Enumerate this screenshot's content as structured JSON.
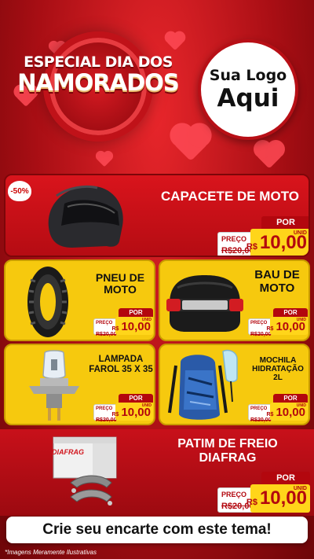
{
  "header": {
    "title_line_1": "ESPECIAL DIA DOS",
    "title_line_2": "NAMORADOS",
    "logo_line_1": "Sua Logo",
    "logo_line_2": "Aqui"
  },
  "colors": {
    "background_red": "#c8101a",
    "card_yellow": "#f6c90e",
    "price_yellow": "#ffd51a",
    "price_red": "#b3070e"
  },
  "products": [
    {
      "name": "CAPACETE DE MOTO",
      "discount": "-50%",
      "por": "POR",
      "preco_label": "PREÇO",
      "old_price": "R$20,00",
      "currency": "R$",
      "price": "10,00",
      "unit": "UNID",
      "icon": "helmet-icon"
    },
    {
      "name": "PNEU DE MOTO",
      "por": "POR",
      "preco_label": "PREÇO",
      "old_price": "R$20,00",
      "currency": "R$",
      "price": "10,00",
      "unit": "UNID",
      "icon": "tire-icon"
    },
    {
      "name": "BAU DE MOTO",
      "por": "POR",
      "preco_label": "PREÇO",
      "old_price": "R$20,00",
      "currency": "R$",
      "price": "10,00",
      "unit": "UNID",
      "icon": "top-case-icon"
    },
    {
      "name": "LAMPADA FAROL 35 X 35",
      "por": "POR",
      "preco_label": "PREÇO",
      "old_price": "R$20,00",
      "currency": "R$",
      "price": "10,00",
      "unit": "UNID",
      "icon": "headlight-bulb-icon"
    },
    {
      "name": "MOCHILA HIDRATAÇÃO 2L",
      "por": "POR",
      "preco_label": "PREÇO",
      "old_price": "R$20,00",
      "currency": "R$",
      "price": "10,00",
      "unit": "UNID",
      "icon": "backpack-icon"
    },
    {
      "name": "PATIM DE FREIO DIAFRAG",
      "por": "POR",
      "preco_label": "PREÇO",
      "old_price": "R$20,00",
      "currency": "R$",
      "price": "10,00",
      "unit": "UNID",
      "icon": "brake-pad-icon",
      "brand_label": "DIAFRAG"
    }
  ],
  "cta": "Crie seu encarte com este tema!",
  "footer": "*Imagens Meramente Ilustrativas"
}
